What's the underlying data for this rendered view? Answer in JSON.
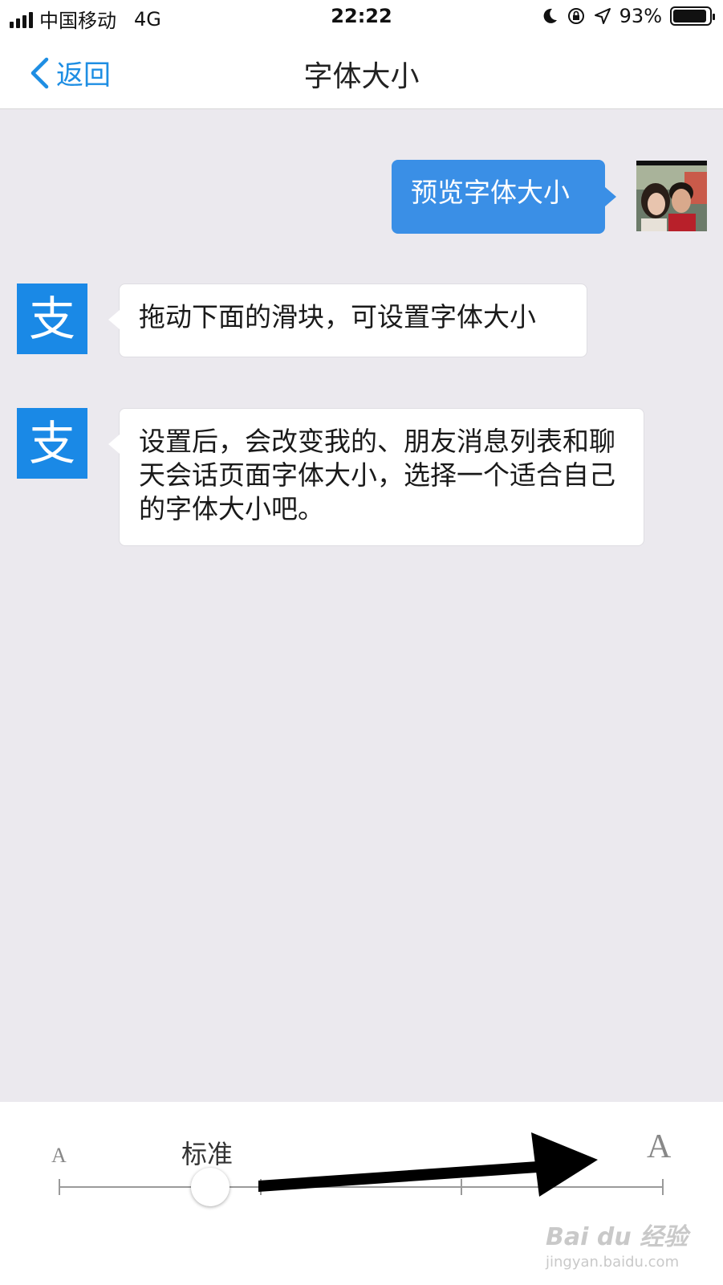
{
  "status_bar": {
    "carrier": "中国移动",
    "network": "4G",
    "time": "22:22",
    "battery": "93%",
    "battery_level": 0.93
  },
  "nav": {
    "back_label": "返回",
    "title": "字体大小"
  },
  "chat": {
    "user_message": "预览字体大小",
    "bot_messages": [
      "拖动下面的滑块，可设置字体大小",
      "设置后，会改变我的、朋友消息列表和聊天会话页面字体大小，选择一个适合自己的字体大小吧。"
    ],
    "bot_avatar_glyph": "支"
  },
  "font_size": {
    "small_label": "A",
    "large_label": "A",
    "current_label": "标准",
    "steps": 4,
    "selected_step": 1
  },
  "watermark": {
    "brand": "Bai du 经验",
    "url": "jingyan.baidu.com"
  },
  "colors": {
    "accent": "#1e8ee3",
    "bubble_blue": "#3a8fe6",
    "alipay_blue": "#1a89e6",
    "background": "#ebe9ee"
  },
  "icons": {
    "back": "chevron-left-icon",
    "moon": "moon-icon",
    "rotation_lock": "rotation-lock-icon",
    "location": "location-arrow-icon",
    "annotation": "arrow-right-annotation"
  }
}
